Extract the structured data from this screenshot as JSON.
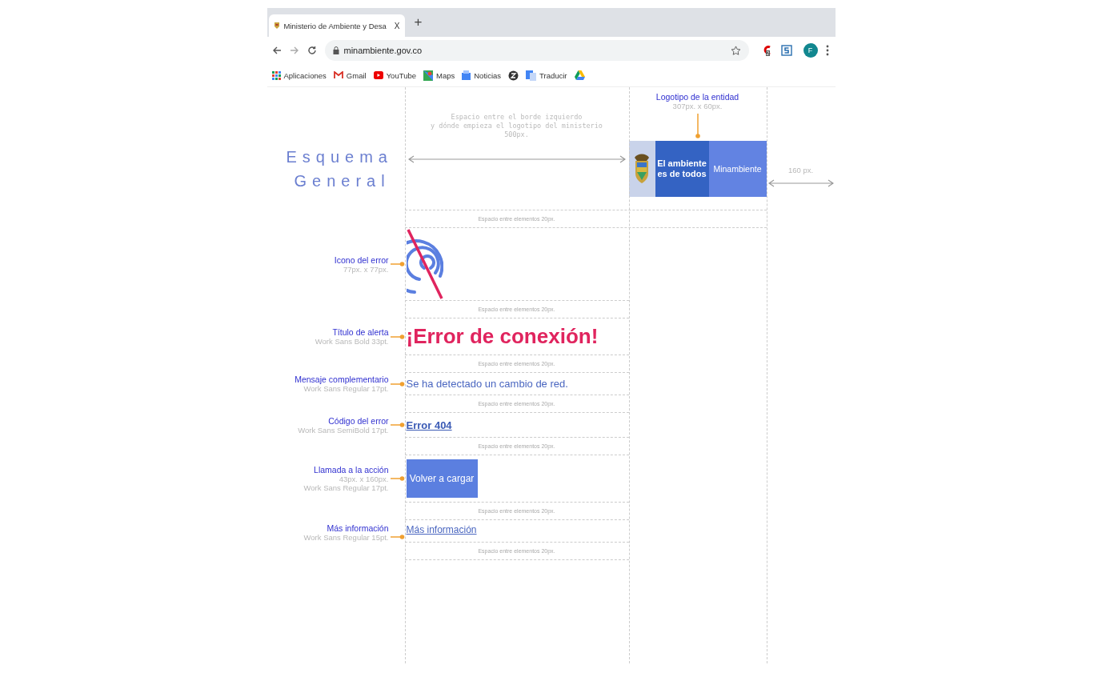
{
  "browser": {
    "tab": {
      "title": "Ministerio de Ambiente y Desa",
      "close": "X"
    },
    "new_tab": "+",
    "url": "minambiente.gov.co",
    "extension_badge": "2",
    "profile": "F",
    "bookmarks": [
      {
        "kind": "apps",
        "label": "Aplicaciones"
      },
      {
        "kind": "gmail",
        "label": "Gmail"
      },
      {
        "kind": "youtube",
        "label": "YouTube"
      },
      {
        "kind": "maps",
        "label": "Maps"
      },
      {
        "kind": "news",
        "label": "Noticias"
      },
      {
        "kind": "site"
      },
      {
        "kind": "translate",
        "label": "Traducir"
      },
      {
        "kind": "drive"
      }
    ]
  },
  "diagram": {
    "heading": [
      "Esquema",
      "General"
    ],
    "left_spacing": [
      "Espacio entre el borde izquierdo",
      "y dónde empieza el logotipo del ministerio",
      "500px."
    ],
    "logo": {
      "label": "Logotipo de la entidad",
      "size": "307px. x 60px.",
      "slogan": [
        "El ambiente",
        "es de todos"
      ],
      "name": "Minambiente"
    },
    "right_spacing": "160 px.",
    "header_spacer": "Espacio entre elementos 20px.",
    "rows": [
      {
        "kind": "icon",
        "label": "Icono del error",
        "specs": [
          "77px. x 77px."
        ],
        "spacer": "Espacio entre elementos 20px."
      },
      {
        "kind": "title",
        "label": "Título de alerta",
        "specs": [
          "Work Sans Bold 33pt."
        ],
        "text": "¡Error de conexión!",
        "spacer": "Espacio entre elementos 20px."
      },
      {
        "kind": "message",
        "label": "Mensaje complementario",
        "specs": [
          "Work Sans Regular 17pt."
        ],
        "text": "Se ha detectado un cambio de red.",
        "spacer": "Espacio entre elementos 20px."
      },
      {
        "kind": "code",
        "label": "Código del error",
        "specs": [
          "Work Sans SemiBold 17pt."
        ],
        "text": "Error 404",
        "spacer": "Espacio entre elementos 20px."
      },
      {
        "kind": "button",
        "label": "Llamada a la acción",
        "specs": [
          "43px. x 160px.",
          "Work Sans Regular 17pt."
        ],
        "text": "Volver a cargar",
        "spacer": "Espacio entre elementos 20px."
      },
      {
        "kind": "link",
        "label": "Más información",
        "specs": [
          "Work Sans Regular 15pt."
        ],
        "text": "Más información",
        "spacer": "Espacio entre elementos 20px."
      }
    ]
  }
}
